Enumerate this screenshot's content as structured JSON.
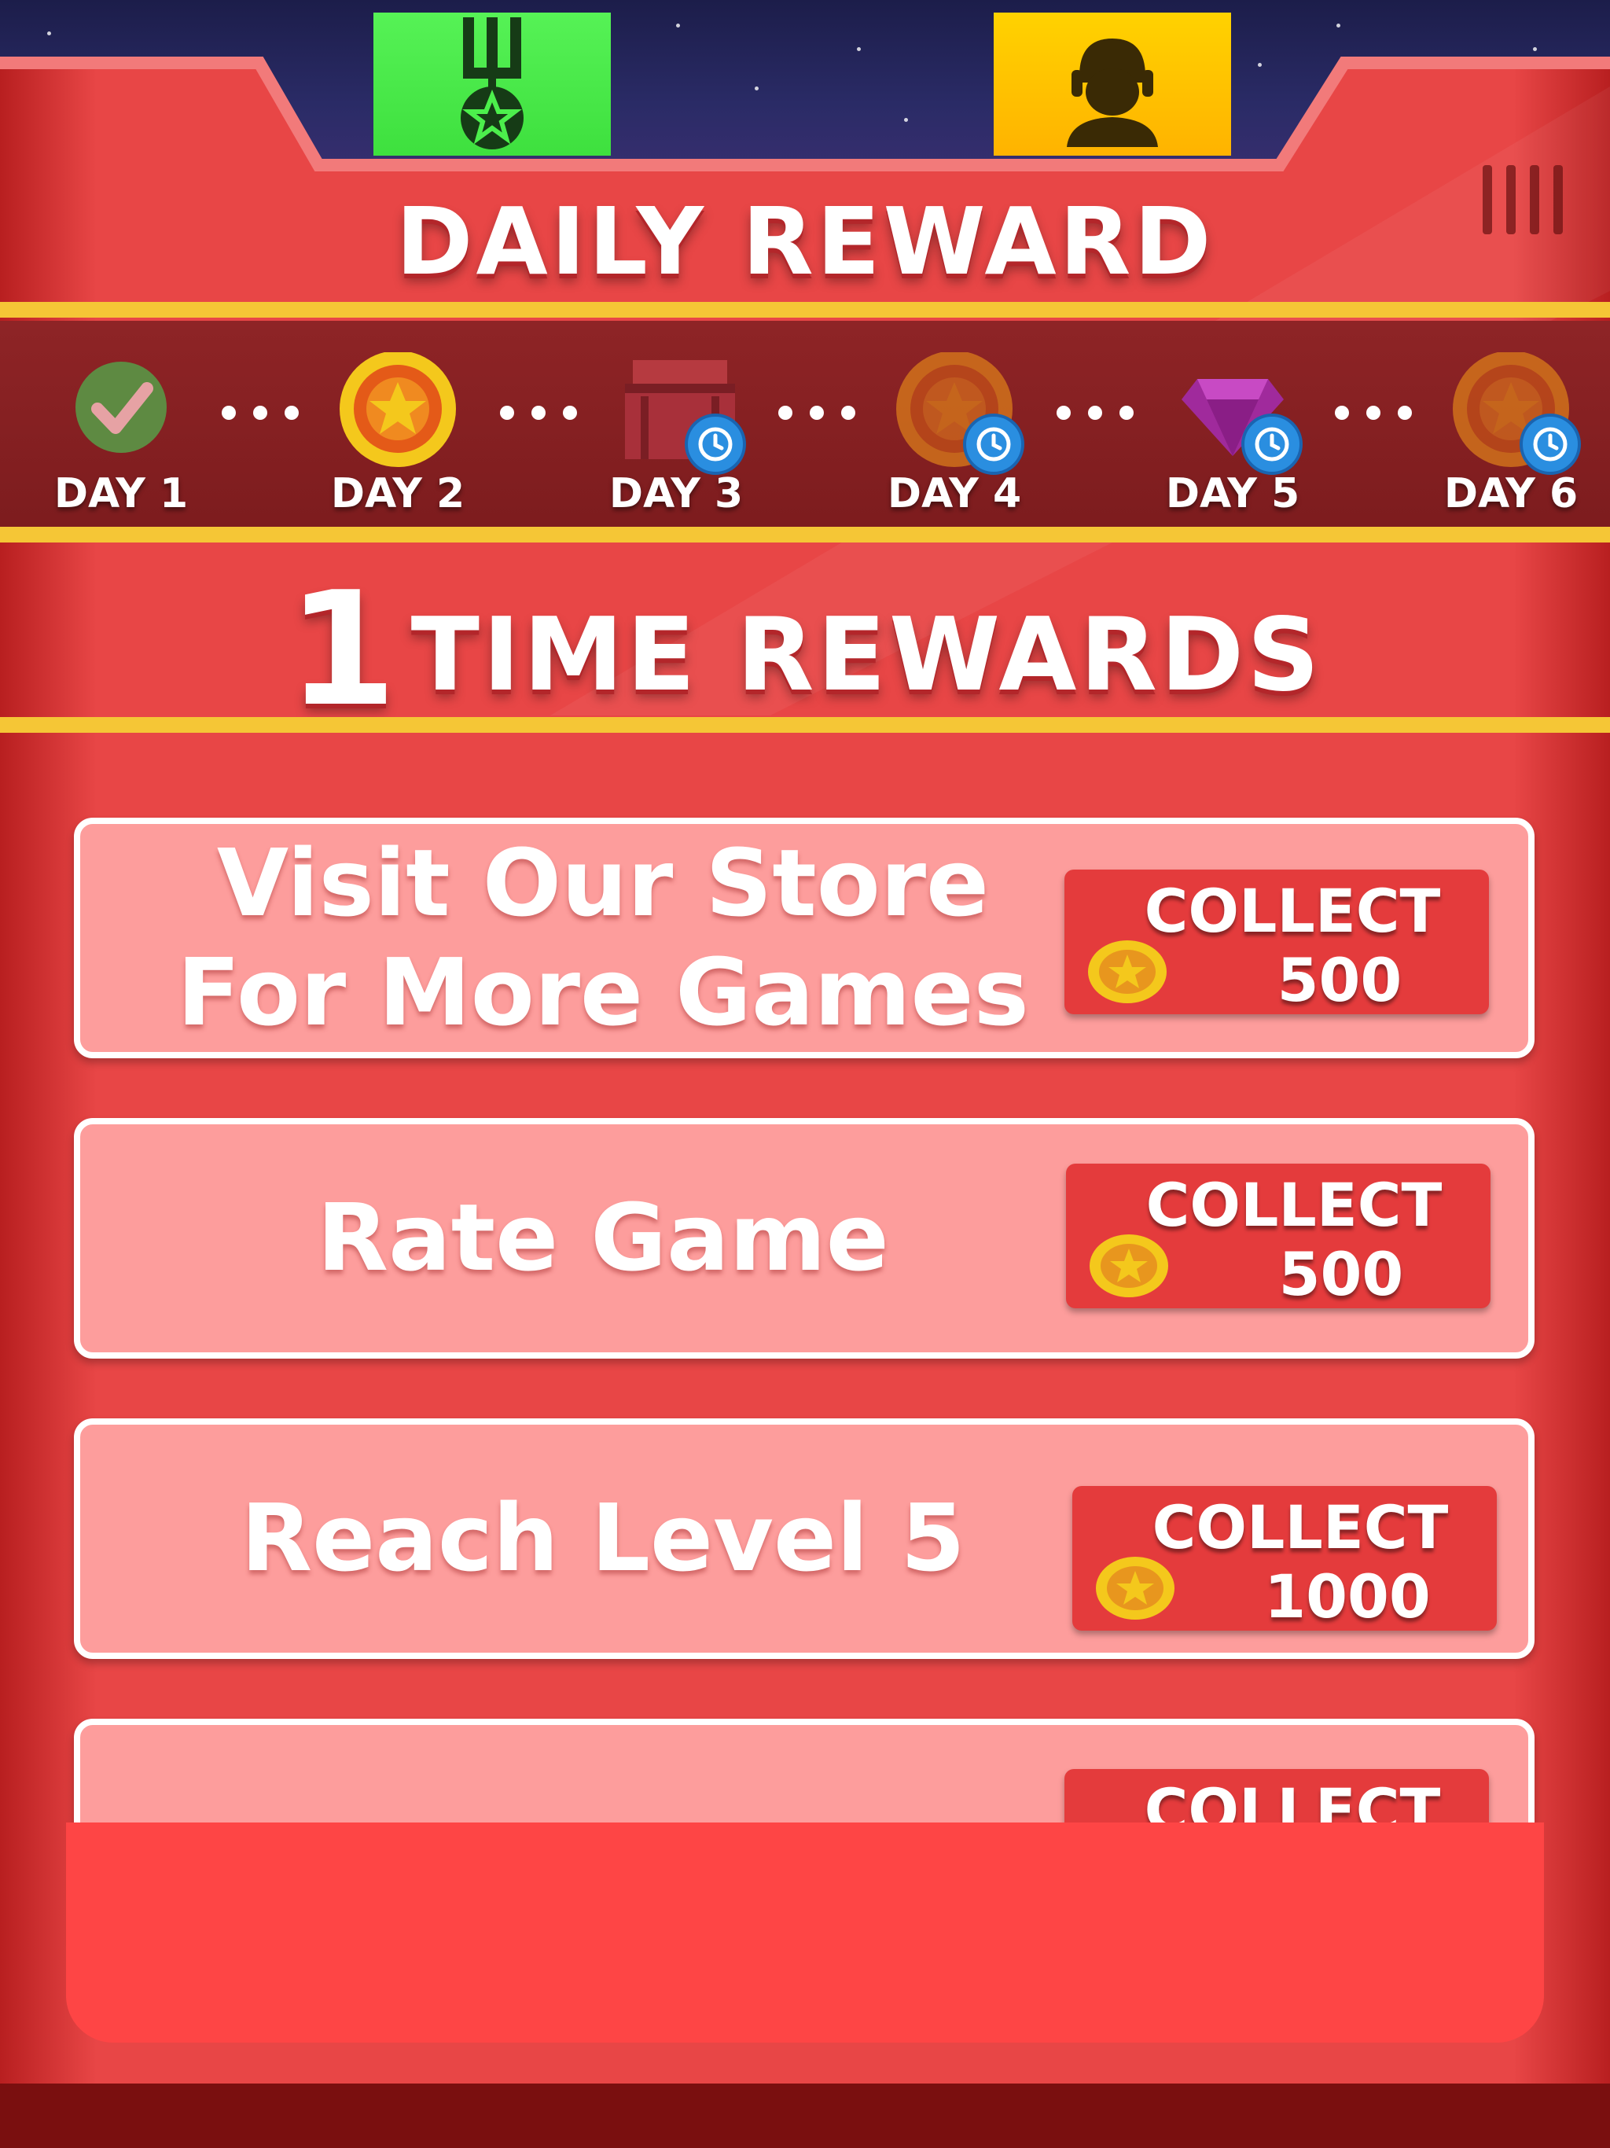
{
  "top_bar": {
    "tabs": [
      {
        "name": "medal-tab",
        "icon": "medal-icon",
        "color": "#4cef4c"
      },
      {
        "name": "profile-tab",
        "icon": "soldier-avatar-icon",
        "color": "#ffc800"
      }
    ]
  },
  "daily_reward": {
    "title": "DAILY REWARD",
    "days": [
      {
        "label": "DAY 1",
        "reward_icon": "checkmark-icon",
        "status": "claimed"
      },
      {
        "label": "DAY 2",
        "reward_icon": "gold-coin-icon",
        "status": "available"
      },
      {
        "label": "DAY 3",
        "reward_icon": "treasure-chest-icon",
        "status": "locked"
      },
      {
        "label": "DAY 4",
        "reward_icon": "gold-coin-icon",
        "status": "locked"
      },
      {
        "label": "DAY 5",
        "reward_icon": "purple-gem-icon",
        "status": "locked"
      },
      {
        "label": "DAY 6",
        "reward_icon": "gold-coin-icon",
        "status": "locked"
      }
    ]
  },
  "one_time_rewards": {
    "title_number": "1",
    "title_text": "TIME REWARDS",
    "items": [
      {
        "text_line1": "Visit Our Store",
        "text_line2": "For More Games",
        "collect_label": "COLLECT",
        "amount": "500"
      },
      {
        "text_line1": "Rate Game",
        "text_line2": "",
        "collect_label": "COLLECT",
        "amount": "500"
      },
      {
        "text_line1": "Reach Level 5",
        "text_line2": "",
        "collect_label": "COLLECT",
        "amount": "1000"
      },
      {
        "text_line1": "",
        "text_line2": "",
        "collect_label": "COLLECT",
        "amount": ""
      }
    ]
  },
  "colors": {
    "panel_red": "#e84646",
    "accent_yellow": "#f5c636",
    "card_pink": "#fd9d9c",
    "button_red": "#e43b3c",
    "clock_blue": "#2a8ee0"
  }
}
